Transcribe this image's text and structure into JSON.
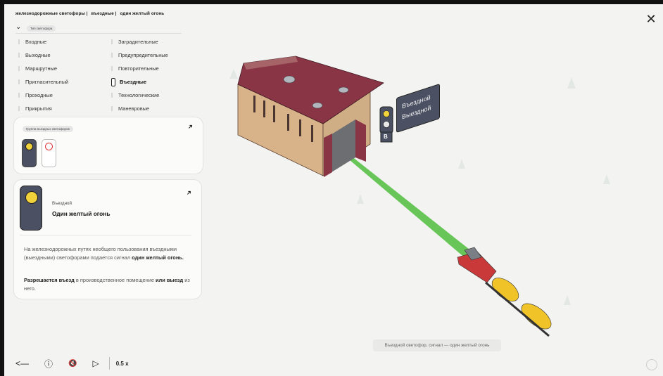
{
  "breadcrumb": [
    "железнодорожные светофоры |",
    "въездные |",
    "один желтый огонь"
  ],
  "type_pill": "Тип светофора",
  "menu_left": [
    "Входные",
    "Выходные",
    "Маршрутные",
    "Пригласительный",
    "Проходные",
    "Прикрытия"
  ],
  "menu_right": [
    "Заградительные",
    "Предупредительные",
    "Повторительные",
    "Въездные",
    "Технологические",
    "Маневровые"
  ],
  "active_item": "Въездные",
  "group_pill": "Группа въездных светофоров",
  "info": {
    "kind": "Въездной",
    "name": "Один желтый огонь",
    "p1_part1": "На железнодорожных путях необщего пользования въездными (выездными) светофорами подается сигнал",
    "p1_bold": "один желтый огонь.",
    "p2_bold1": "Разрешается въезд",
    "p2_part1": "в производственное помещение",
    "p2_bold2": "или выезд",
    "p2_part2": "из него."
  },
  "sign": {
    "line1": "Въездной",
    "line2": "Выездной"
  },
  "signal_letter": "В",
  "caption": "Въездной светофор, сигнал — один желтый огонь",
  "controls": {
    "back": "<—",
    "info": "ⓘ",
    "mute": "🔇",
    "play": "▷",
    "speed": "0.5 x"
  },
  "close": "✕",
  "colors": {
    "yellow_lamp": "#f2d23a",
    "signal_body": "#4b5163",
    "track_green": "#4fbf3a",
    "roof": "#8a3546",
    "wall": "#d7b98f"
  }
}
